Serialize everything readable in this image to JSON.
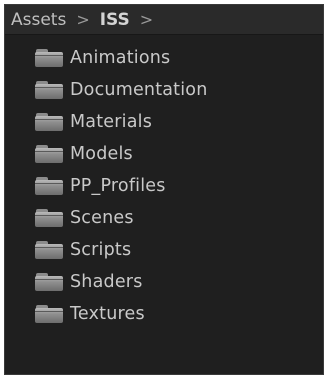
{
  "breadcrumb": {
    "root": "Assets",
    "separator": ">",
    "current": "ISS",
    "trailing_separator": ">"
  },
  "folders": [
    {
      "label": "Animations",
      "icon": "folder-icon"
    },
    {
      "label": "Documentation",
      "icon": "folder-icon"
    },
    {
      "label": "Materials",
      "icon": "folder-icon"
    },
    {
      "label": "Models",
      "icon": "folder-icon"
    },
    {
      "label": "PP_Profiles",
      "icon": "folder-icon"
    },
    {
      "label": "Scenes",
      "icon": "folder-icon"
    },
    {
      "label": "Scripts",
      "icon": "folder-icon"
    },
    {
      "label": "Shaders",
      "icon": "folder-icon"
    },
    {
      "label": "Textures",
      "icon": "folder-icon"
    }
  ],
  "colors": {
    "panel_background": "#1f1f1f",
    "header_background": "#2a2a2a",
    "text": "#c9c9c9",
    "folder_icon": "#8f8f8f"
  }
}
